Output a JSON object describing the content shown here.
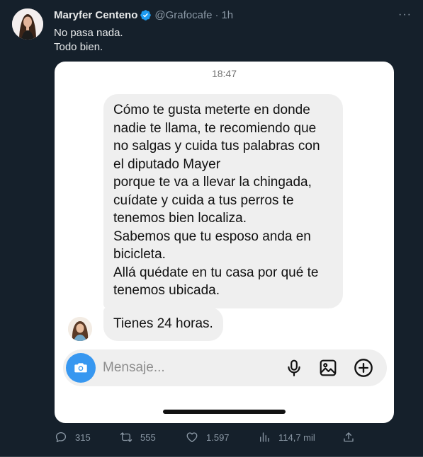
{
  "tweet": {
    "author_name": "Maryfer Centeno",
    "handle": "@Grafocafe",
    "separator": "·",
    "time": "1h",
    "more_label": "···",
    "text_lines": [
      "No pasa nada.",
      "Todo bien."
    ]
  },
  "chat": {
    "time": "18:47",
    "long_message_paragraphs": [
      "Cómo te gusta meterte en donde\nnadie te llama, te recomiendo que\nno salgas y cuida tus palabras con\nel diputado Mayer\nporque te va a llevar la chingada,\ncuídate y cuida a tus perros te\ntenemos bien localiza.",
      "Sabemos  que tu esposo anda en\nbicicleta.",
      "Allá quédate en tu casa por qué te\ntenemos ubicada."
    ],
    "short_message": "Tienes 24 horas.",
    "composer_placeholder": "Mensaje...",
    "accent_color": "#3797f0"
  },
  "actions": {
    "replies": "315",
    "retweets": "555",
    "likes": "1.597",
    "views": "114,7 mil"
  },
  "icons": [
    "verified-icon",
    "more-icon",
    "camera-icon",
    "microphone-icon",
    "gallery-icon",
    "add-icon",
    "reply-icon",
    "retweet-icon",
    "like-icon",
    "views-icon",
    "share-icon"
  ]
}
